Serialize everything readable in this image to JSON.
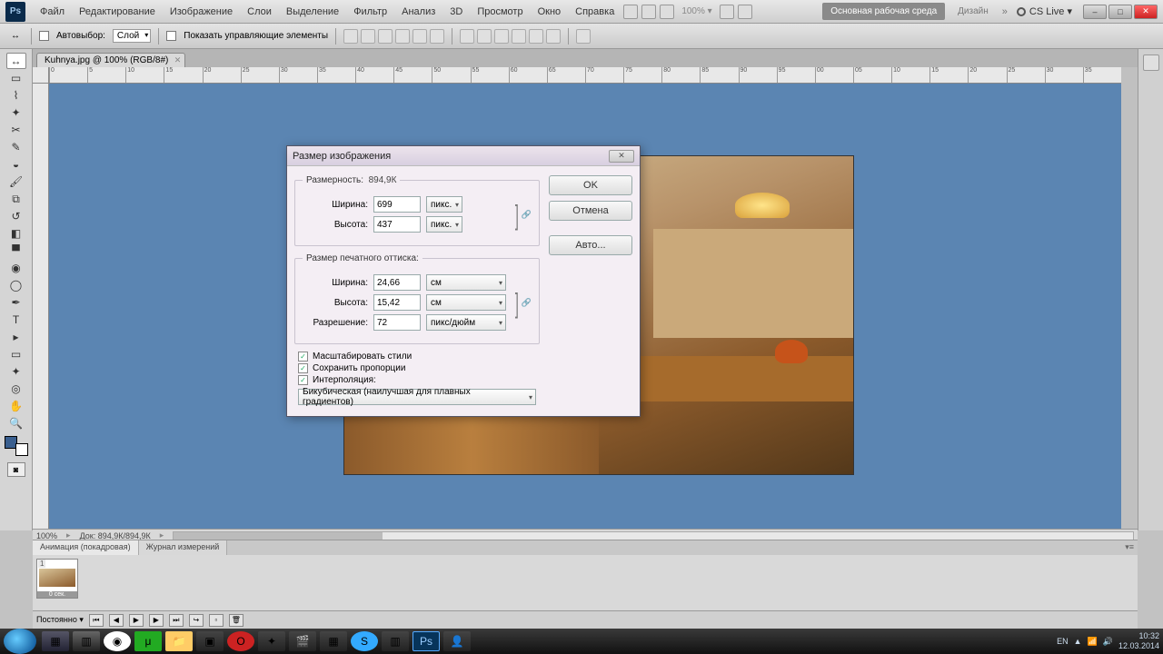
{
  "app": {
    "logo": "Ps",
    "cslive": "CS Live ▾"
  },
  "menu": [
    "Файл",
    "Редактирование",
    "Изображение",
    "Слои",
    "Выделение",
    "Фильтр",
    "Анализ",
    "3D",
    "Просмотр",
    "Окно",
    "Справка"
  ],
  "workspace": {
    "primary": "Основная рабочая среда",
    "design": "Дизайн",
    "more": "»"
  },
  "topzoom": "100% ▾",
  "options": {
    "autoselect_label": "Автовыбор:",
    "autoselect_value": "Слой",
    "show_controls": "Показать управляющие элементы"
  },
  "doctab": {
    "label": "Kuhnya.jpg @ 100% (RGB/8#)"
  },
  "ruler_ticks": [
    "0",
    "5",
    "10",
    "15",
    "20",
    "25",
    "30",
    "35",
    "40",
    "45",
    "50",
    "55",
    "60",
    "65",
    "70",
    "75",
    "80",
    "85",
    "90",
    "95",
    "00",
    "05",
    "10",
    "15",
    "20",
    "25",
    "30",
    "35"
  ],
  "dialog": {
    "title": "Размер изображения",
    "pixeldim_legend": "Размерность:",
    "pixeldim_size": "894,9К",
    "width_label": "Ширина:",
    "height_label": "Высота:",
    "px_width": "699",
    "px_height": "437",
    "px_unit": "пикс.",
    "print_legend": "Размер печатного оттиска:",
    "print_width": "24,66",
    "print_height": "15,42",
    "print_unit": "см",
    "res_label": "Разрешение:",
    "res_value": "72",
    "res_unit": "пикс/дюйм",
    "chk_scale": "Масштабировать стили",
    "chk_constrain": "Сохранить пропорции",
    "chk_interp": "Интерполяция:",
    "interp_value": "Бикубическая (наилучшая для плавных градиентов)",
    "btn_ok": "OK",
    "btn_cancel": "Отмена",
    "btn_auto": "Авто..."
  },
  "status": {
    "zoom": "100%",
    "docsize": "Док: 894,9К/894,9К"
  },
  "panels": {
    "tab_anim": "Анимация (покадровая)",
    "tab_log": "Журнал измерений",
    "frame1_num": "1",
    "frame1_time": "0 сек.",
    "loop": "Постоянно ▾"
  },
  "taskbar": {
    "lang": "EN",
    "time": "10:32",
    "date": "12.03.2014"
  }
}
